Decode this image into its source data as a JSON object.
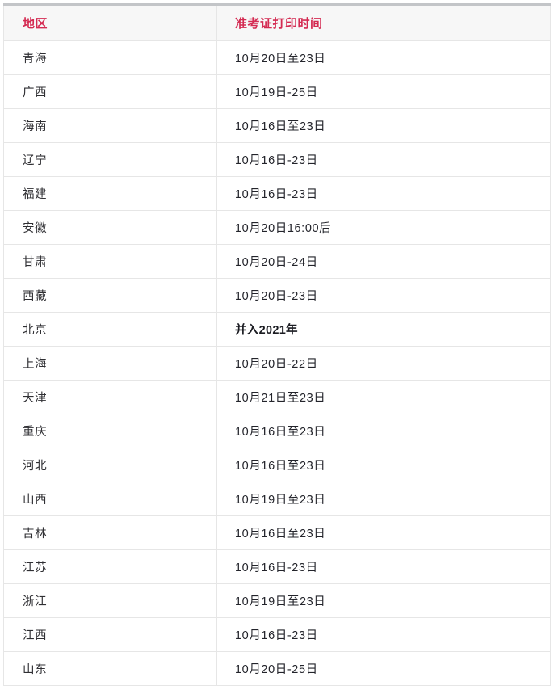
{
  "table": {
    "columns": [
      {
        "key": "region",
        "label": "地区"
      },
      {
        "key": "time",
        "label": "准考证打印时间"
      }
    ],
    "header_text_color": "#d42b52",
    "header_bg_color": "#f7f7f7",
    "border_color": "#e6e6e6",
    "top_border_color": "#c3c5c8",
    "body_text_color": "#2f2f33",
    "rows": [
      {
        "region": "青海",
        "time": "10月20日至23日",
        "bold": false
      },
      {
        "region": "广西",
        "time": "10月19日-25日",
        "bold": false
      },
      {
        "region": "海南",
        "time": "10月16日至23日",
        "bold": false
      },
      {
        "region": "辽宁",
        "time": "10月16日-23日",
        "bold": false
      },
      {
        "region": "福建",
        "time": "10月16日-23日",
        "bold": false
      },
      {
        "region": "安徽",
        "time": "10月20日16:00后",
        "bold": false
      },
      {
        "region": "甘肃",
        "time": "10月20日-24日",
        "bold": false
      },
      {
        "region": "西藏",
        "time": "10月20日-23日",
        "bold": false
      },
      {
        "region": "北京",
        "time": "并入2021年",
        "bold": true
      },
      {
        "region": "上海",
        "time": "10月20日-22日",
        "bold": false
      },
      {
        "region": "天津",
        "time": "10月21日至23日",
        "bold": false
      },
      {
        "region": "重庆",
        "time": "10月16日至23日",
        "bold": false
      },
      {
        "region": "河北",
        "time": "10月16日至23日",
        "bold": false
      },
      {
        "region": "山西",
        "time": "10月19日至23日",
        "bold": false
      },
      {
        "region": "吉林",
        "time": "10月16日至23日",
        "bold": false
      },
      {
        "region": "江苏",
        "time": "10月16日-23日",
        "bold": false
      },
      {
        "region": "浙江",
        "time": "10月19日至23日",
        "bold": false
      },
      {
        "region": "江西",
        "time": "10月16日-23日",
        "bold": false
      },
      {
        "region": "山东",
        "time": "10月20日-25日",
        "bold": false
      }
    ]
  }
}
